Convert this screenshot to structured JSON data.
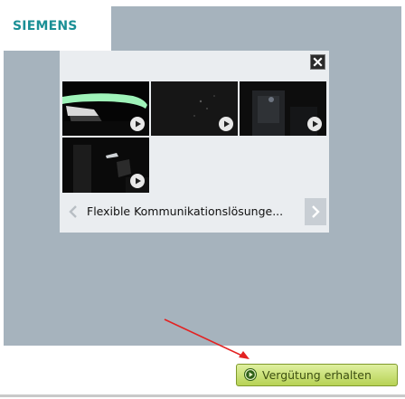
{
  "brand": {
    "logo_text": "SIEMENS"
  },
  "gallery": {
    "caption": "Flexible Kommunikationslösunge...",
    "thumbnails": [
      {
        "name": "thumbnail-headset"
      },
      {
        "name": "thumbnail-dark-screen"
      },
      {
        "name": "thumbnail-dark-device"
      },
      {
        "name": "thumbnail-desk-phone"
      }
    ],
    "close_icon": "close-icon",
    "prev_icon": "chevron-left-icon",
    "next_icon": "chevron-right-icon",
    "play_icon": "play-icon"
  },
  "cta": {
    "label": "Vergütung erhalten",
    "icon": "play-circle-icon",
    "color": "#b7d255"
  },
  "colors": {
    "brand": "#1a8f95",
    "backdrop": "#a6b3bd",
    "annotation_arrow": "#e32222"
  }
}
